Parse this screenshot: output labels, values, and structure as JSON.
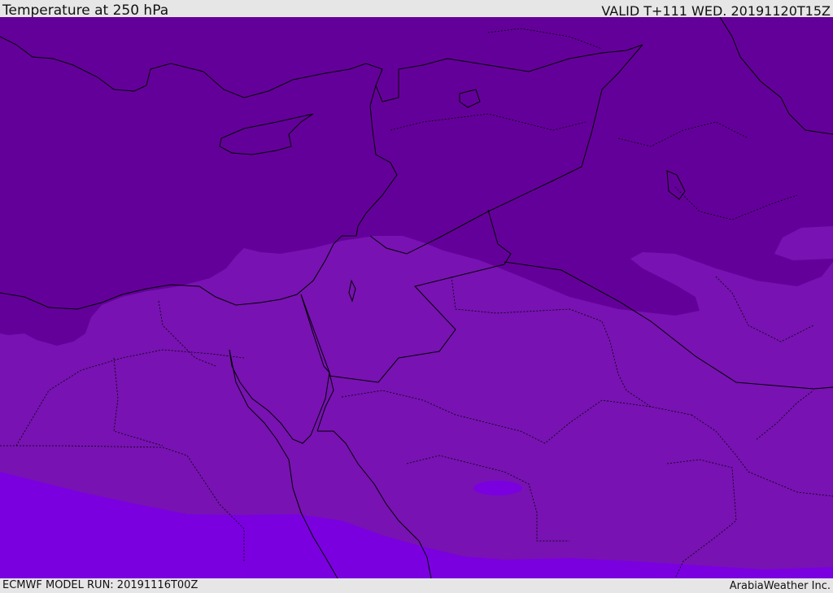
{
  "header": {
    "title": "Temperature at 250 hPa",
    "valid": "VALID T+111 WED. 20191120T15Z"
  },
  "footer": {
    "model_run": "ECMWF MODEL RUN: 20191116T00Z",
    "credit": "ArabiaWeather Inc."
  },
  "colors": {
    "band_cold": "#64009a",
    "band_mid": "#7812b2",
    "band_warm": "#7a00e0",
    "coastline": "#000000",
    "bar_background": "#e6e6e6"
  }
}
